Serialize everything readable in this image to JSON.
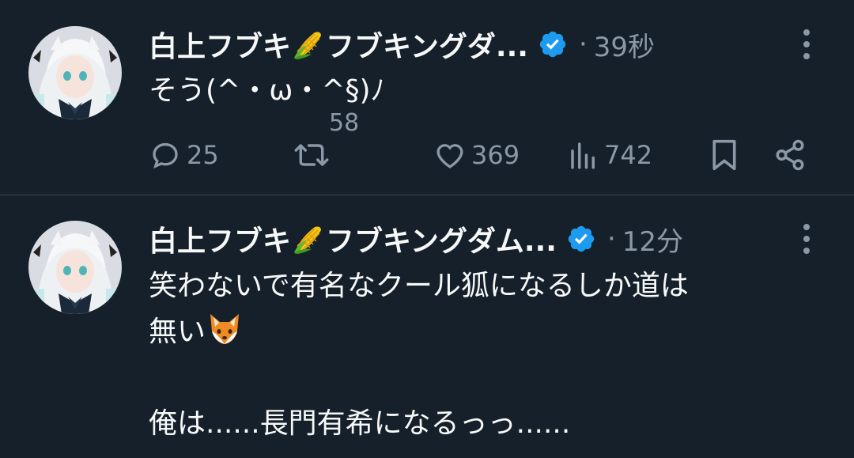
{
  "tweets": [
    {
      "name_prefix": "白上フブキ",
      "name_suffix": "フブキングダ...",
      "time": "39秒",
      "dot": "·",
      "text": "そう(^・ω・^§)ﾉ",
      "actions": {
        "replies": "25",
        "retweets": "58",
        "likes": "369",
        "views": "742"
      }
    },
    {
      "name_prefix": "白上フブキ",
      "name_suffix": "フブキングダム...",
      "time": "12分",
      "dot": "·",
      "text_line1": "笑わないで有名なクール狐になるしか道は",
      "text_line2": "無い",
      "text_line3": "",
      "text_line4": "俺は......長門有希になるっっ......"
    }
  ],
  "icons": {
    "verified": "verified-badge-icon",
    "corn": "corn-emoji-icon",
    "fox": "fox-emoji-icon",
    "more": "more-vertical-icon",
    "reply": "reply-icon",
    "retweet": "retweet-icon",
    "like": "heart-icon",
    "views": "views-icon",
    "bookmark": "bookmark-icon",
    "share": "share-icon"
  },
  "colors": {
    "background": "#15202b",
    "text": "#f7f9f9",
    "muted": "#8b98a5",
    "verified": "#1d9bf0"
  }
}
